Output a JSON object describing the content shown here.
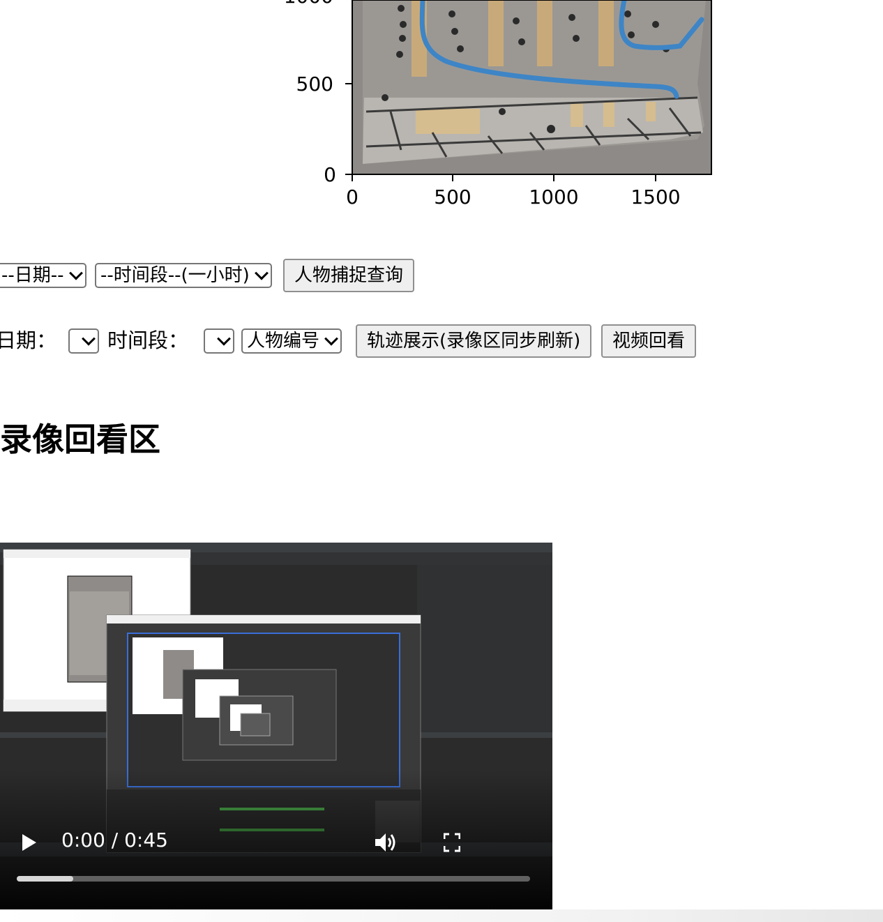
{
  "plot": {
    "y_ticks": [
      "1000",
      "500",
      "0"
    ],
    "x_ticks": [
      "0",
      "500",
      "1000",
      "1500"
    ],
    "trajectory_color": "#3d85c6"
  },
  "query_row": {
    "date_select": "--日期--",
    "time_select": "--时间段--(一小时)",
    "capture_button": "人物捕捉查询"
  },
  "track_row": {
    "date_label": "日期：",
    "time_label": "时间段：",
    "person_select": "人物编号",
    "track_button": "轨迹展示(录像区同步刷新)",
    "replay_button": "视频回看"
  },
  "section_title": "录像回看区",
  "video": {
    "current_time": "0:00",
    "duration": "0:45",
    "time_display": "0:00 / 0:45",
    "played_fraction": 0.11,
    "icons": [
      "play-icon",
      "volume-icon",
      "fullscreen-icon"
    ]
  }
}
